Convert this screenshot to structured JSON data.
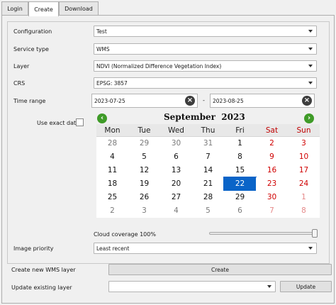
{
  "tabs": [
    {
      "label": "Login"
    },
    {
      "label": "Create",
      "active": true
    },
    {
      "label": "Download"
    }
  ],
  "form": {
    "configuration": {
      "label": "Configuration",
      "value": "Test"
    },
    "service_type": {
      "label": "Service type",
      "value": "WMS"
    },
    "layer": {
      "label": "Layer",
      "value": "NDVI (Normalized Difference Vegetation Index)"
    },
    "crs": {
      "label": "CRS",
      "value": "EPSG: 3857"
    },
    "time_range": {
      "label": "Time range",
      "start": "2023-07-25",
      "separator": "-",
      "end": "2023-08-25"
    },
    "use_exact_date": {
      "label": "Use exact date",
      "checked": false
    },
    "cloud_coverage": {
      "label": "Cloud coverage 100%",
      "value_percent": 100
    },
    "image_priority": {
      "label": "Image priority",
      "value": "Least recent"
    }
  },
  "calendar": {
    "month": "September",
    "year": "2023",
    "weekdays": [
      "Mon",
      "Tue",
      "Wed",
      "Thu",
      "Fri",
      "Sat",
      "Sun"
    ],
    "weeks": [
      [
        "28",
        "29",
        "30",
        "31",
        "1",
        "2",
        "3"
      ],
      [
        "4",
        "5",
        "6",
        "7",
        "8",
        "9",
        "10"
      ],
      [
        "11",
        "12",
        "13",
        "14",
        "15",
        "16",
        "17"
      ],
      [
        "18",
        "19",
        "20",
        "21",
        "22",
        "23",
        "24"
      ],
      [
        "25",
        "26",
        "27",
        "28",
        "29",
        "30",
        "1"
      ],
      [
        "2",
        "3",
        "4",
        "5",
        "6",
        "7",
        "8"
      ]
    ],
    "selected_day": "22",
    "nav_color": "#3f9b28",
    "selected_color": "#0a64c8",
    "weekend_color": "#c00000"
  },
  "bottom": {
    "create_new": {
      "label": "Create new WMS layer",
      "button": "Create"
    },
    "update_existing": {
      "label": "Update existing layer",
      "value": "",
      "button": "Update"
    }
  }
}
